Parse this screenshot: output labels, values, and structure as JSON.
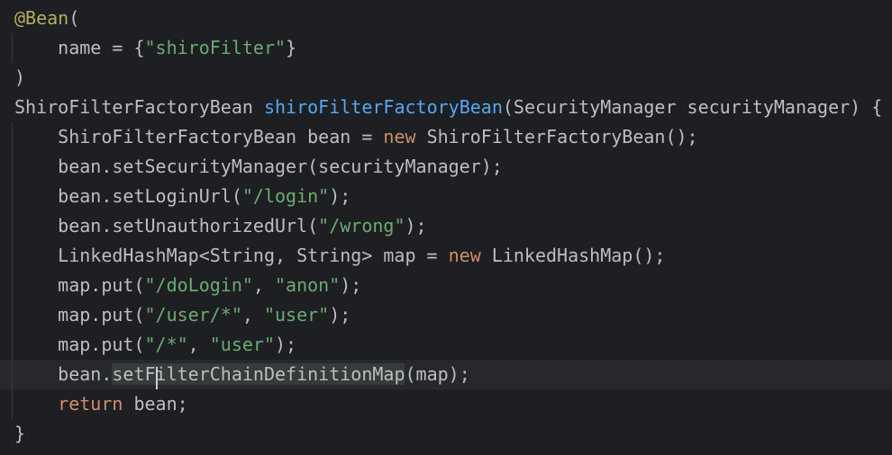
{
  "editor": {
    "colors": {
      "background": "#1e1f22",
      "text": "#bcbec4",
      "annotation": "#b3ae60",
      "string": "#6aab73",
      "keyword": "#cf8e6d",
      "method_declaration": "#56a8f5",
      "current_line": "#26282e",
      "selection": "#373b39"
    },
    "current_line_index": 12,
    "selection": {
      "line": 12,
      "text": "setFilterChainDefinitionMap",
      "caret_after_chars": 4
    },
    "lines": [
      [
        [
          "annotation",
          "@Bean"
        ],
        [
          "plain",
          "("
        ]
      ],
      [
        [
          "plain",
          "    name = {"
        ],
        [
          "string",
          "\"shiroFilter\""
        ],
        [
          "plain",
          "}"
        ]
      ],
      [
        [
          "plain",
          ")"
        ]
      ],
      [
        [
          "plain",
          "ShiroFilterFactoryBean "
        ],
        [
          "method-decl",
          "shiroFilterFactoryBean"
        ],
        [
          "plain",
          "(SecurityManager securityManager) {"
        ]
      ],
      [
        [
          "plain",
          "    ShiroFilterFactoryBean bean = "
        ],
        [
          "keyword",
          "new"
        ],
        [
          "plain",
          " ShiroFilterFactoryBean();"
        ]
      ],
      [
        [
          "plain",
          "    bean.setSecurityManager(securityManager);"
        ]
      ],
      [
        [
          "plain",
          "    bean.setLoginUrl("
        ],
        [
          "string",
          "\"/login\""
        ],
        [
          "plain",
          ");"
        ]
      ],
      [
        [
          "plain",
          "    bean.setUnauthorizedUrl("
        ],
        [
          "string",
          "\"/wrong\""
        ],
        [
          "plain",
          ");"
        ]
      ],
      [
        [
          "plain",
          "    LinkedHashMap<String, String> map = "
        ],
        [
          "keyword",
          "new"
        ],
        [
          "plain",
          " LinkedHashMap();"
        ]
      ],
      [
        [
          "plain",
          "    map.put("
        ],
        [
          "string",
          "\"/doLogin\""
        ],
        [
          "plain",
          ", "
        ],
        [
          "string",
          "\"anon\""
        ],
        [
          "plain",
          ");"
        ]
      ],
      [
        [
          "plain",
          "    map.put("
        ],
        [
          "string",
          "\"/user/*\""
        ],
        [
          "plain",
          ", "
        ],
        [
          "string",
          "\"user\""
        ],
        [
          "plain",
          ");"
        ]
      ],
      [
        [
          "plain",
          "    map.put("
        ],
        [
          "string",
          "\"/*\""
        ],
        [
          "plain",
          ", "
        ],
        [
          "string",
          "\"user\""
        ],
        [
          "plain",
          ");"
        ]
      ],
      [
        [
          "plain",
          "    bean."
        ],
        [
          "selected",
          "setFilterChainDefinitionMap"
        ],
        [
          "plain",
          "(map);"
        ]
      ],
      [
        [
          "plain",
          "    "
        ],
        [
          "keyword",
          "return"
        ],
        [
          "plain",
          " bean;"
        ]
      ],
      [
        [
          "plain",
          "}"
        ]
      ]
    ]
  }
}
